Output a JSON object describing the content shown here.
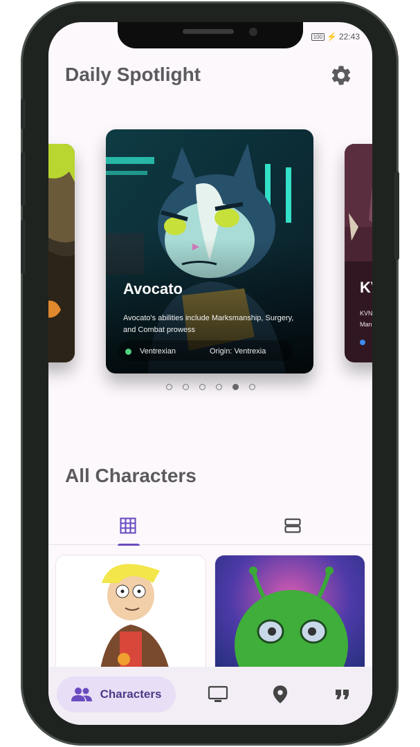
{
  "status_bar": {
    "time": "22:43",
    "battery": "100"
  },
  "header": {
    "title": "Daily Spotlight",
    "settings_icon": "gear-icon"
  },
  "spotlight": {
    "featured": {
      "name": "Avocato",
      "description": "Avocato's abilities include Marksmanship, Surgery, and Combat prowess",
      "status": "Ventrexian",
      "origin": "Origin: Ventrexia",
      "status_color": "#4fd27f"
    },
    "next_card": {
      "name": "KV",
      "line1": "KVN",
      "line2": "Man"
    },
    "pagination": {
      "total": 6,
      "active_index": 4
    }
  },
  "all_characters": {
    "title": "All Characters",
    "tabs": [
      {
        "icon": "grid-view-icon",
        "selected": true
      },
      {
        "icon": "list-view-icon",
        "selected": false
      }
    ]
  },
  "bottom_nav": {
    "items": [
      {
        "label": "Characters",
        "icon": "people-icon",
        "selected": true
      },
      {
        "label": "",
        "icon": "tv-icon",
        "selected": false
      },
      {
        "label": "",
        "icon": "location-pin-icon",
        "selected": false
      },
      {
        "label": "",
        "icon": "quote-icon",
        "selected": false
      }
    ]
  },
  "colors": {
    "accent": "#6a4cc0",
    "background": "#fcf8fc",
    "nav_pill": "#e8def6"
  }
}
